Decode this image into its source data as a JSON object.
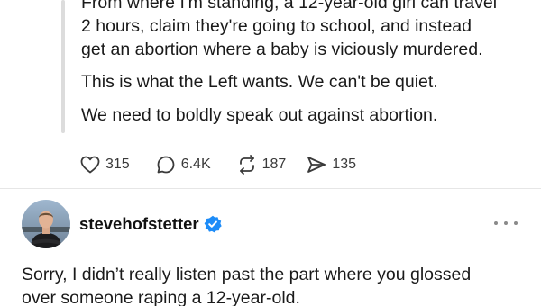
{
  "quoted_post": {
    "lines": [
      "From where I'm standing, a 12-year-old girl can travel",
      "2 hours, claim they're going to school, and instead",
      "get an abortion where a baby is viciously murdered.",
      "This is what the Left wants. We can't be quiet.",
      "We need to boldly speak out against abortion."
    ],
    "stats": {
      "likes": "315",
      "comments": "6.4K",
      "reposts": "187",
      "shares": "135"
    }
  },
  "reply_post": {
    "username": "stevehofstetter",
    "verified": true,
    "lines": [
      "Sorry, I didn’t really listen past the part where you glossed",
      "over someone raping a 12-year-old."
    ]
  },
  "colors": {
    "verified_badge": "#1d8cf8",
    "thread_line": "#dcdcdc",
    "icon": "#3a3a3a"
  },
  "icons": [
    "heart-icon",
    "comment-icon",
    "repost-icon",
    "share-icon",
    "verified-icon",
    "more-icon"
  ]
}
